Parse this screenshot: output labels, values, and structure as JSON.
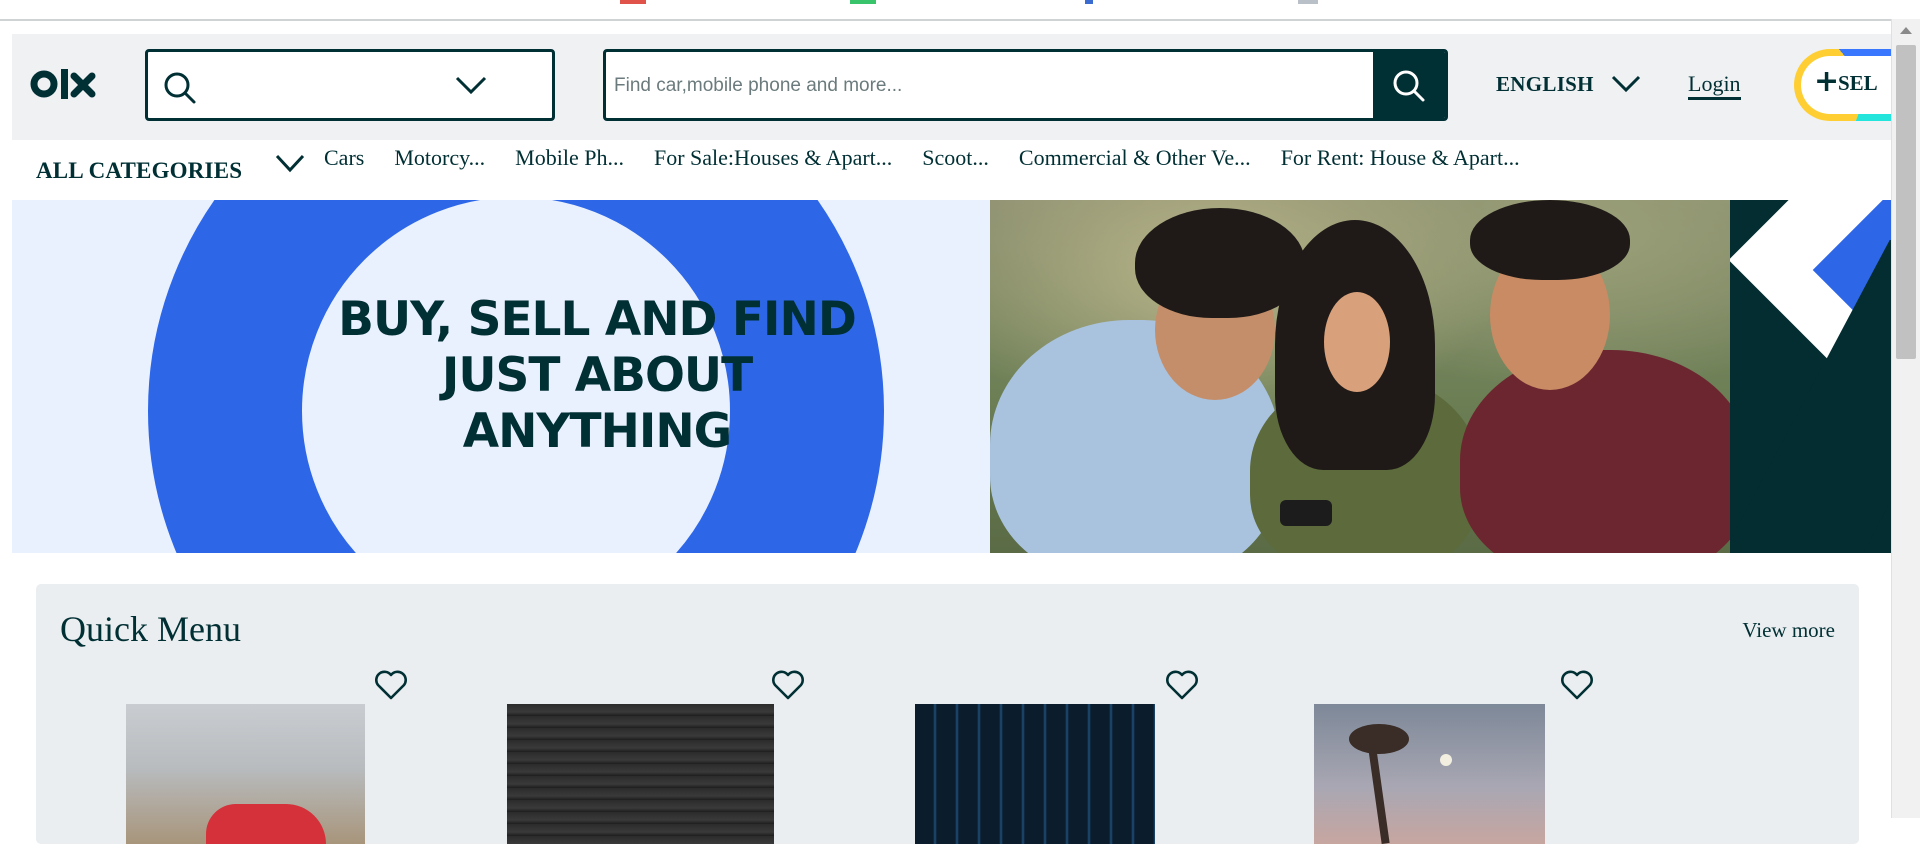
{
  "header": {
    "logo_text": "olx",
    "location_placeholder": "",
    "search_placeholder": "Find car,mobile phone and more...",
    "language_label": "ENGLISH",
    "login_label": "Login",
    "sell_label": "SEL"
  },
  "categories": {
    "all_label": "ALL CATEGORIES",
    "items": [
      {
        "label": "Cars"
      },
      {
        "label": "Motorcy..."
      },
      {
        "label": "Mobile Ph..."
      },
      {
        "label": "For Sale:Houses & Apart..."
      },
      {
        "label": "Scoot..."
      },
      {
        "label": "Commercial & Other Ve..."
      },
      {
        "label": "For Rent: House & Apart..."
      }
    ]
  },
  "banner": {
    "headline": "BUY, SELL AND FIND JUST ABOUT ANYTHING"
  },
  "quick_menu": {
    "title": "Quick Menu",
    "view_more": "View more",
    "cards": [
      {
        "image": "red-car-photo",
        "favorite_icon": "heart-icon"
      },
      {
        "image": "dark-texture-photo",
        "favorite_icon": "heart-icon"
      },
      {
        "image": "city-night-photo",
        "favorite_icon": "heart-icon"
      },
      {
        "image": "tree-moon-photo",
        "favorite_icon": "heart-icon"
      }
    ]
  },
  "colors": {
    "brand_dark": "#002f34",
    "header_bg": "#eff1f3",
    "banner_blue": "#2d67e8",
    "sell_yellow": "#ffce32",
    "sell_teal": "#23e5db"
  }
}
